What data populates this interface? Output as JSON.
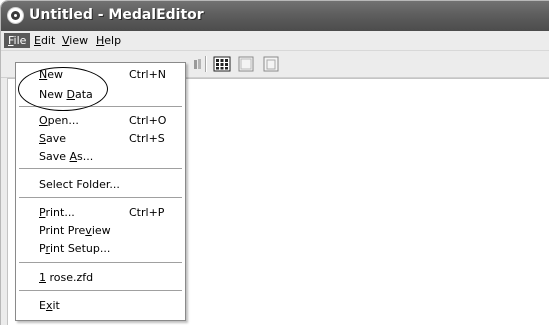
{
  "window": {
    "title": "Untitled - MedalEditor"
  },
  "menubar": {
    "file": {
      "pre": "",
      "accel": "F",
      "post": "ile"
    },
    "edit": {
      "pre": "",
      "accel": "E",
      "post": "dit"
    },
    "view": {
      "pre": "",
      "accel": "V",
      "post": "iew"
    },
    "help": {
      "pre": "",
      "accel": "H",
      "post": "elp"
    }
  },
  "file_menu": {
    "new": {
      "pre": "",
      "accel": "N",
      "post": "ew",
      "shortcut": "Ctrl+N"
    },
    "new_data": {
      "pre": "New ",
      "accel": "D",
      "post": "ata"
    },
    "open": {
      "pre": "",
      "accel": "O",
      "post": "pen...",
      "shortcut": "Ctrl+O"
    },
    "save": {
      "pre": "",
      "accel": "S",
      "post": "ave",
      "shortcut": "Ctrl+S"
    },
    "save_as": {
      "pre": "Save ",
      "accel": "A",
      "post": "s..."
    },
    "select_folder": {
      "label": "Select Folder..."
    },
    "print": {
      "pre": "",
      "accel": "P",
      "post": "rint...",
      "shortcut": "Ctrl+P"
    },
    "print_preview": {
      "pre": "Print Pre",
      "accel": "v",
      "post": "iew"
    },
    "print_setup": {
      "pre": "P",
      "accel": "r",
      "post": "int Setup..."
    },
    "recent_1": {
      "pre": "",
      "accel": "1",
      "post": " rose.zfd"
    },
    "exit": {
      "pre": "E",
      "accel": "x",
      "post": "it"
    }
  },
  "toolbar": {
    "icons": [
      "hidden-button-icon",
      "grid-view-icon",
      "page-icon",
      "page-outline-icon"
    ]
  },
  "colors": {
    "title_bar": "#5e5e5e",
    "menu_highlight": "#5a5a5a",
    "menu_bg": "#ececec"
  }
}
